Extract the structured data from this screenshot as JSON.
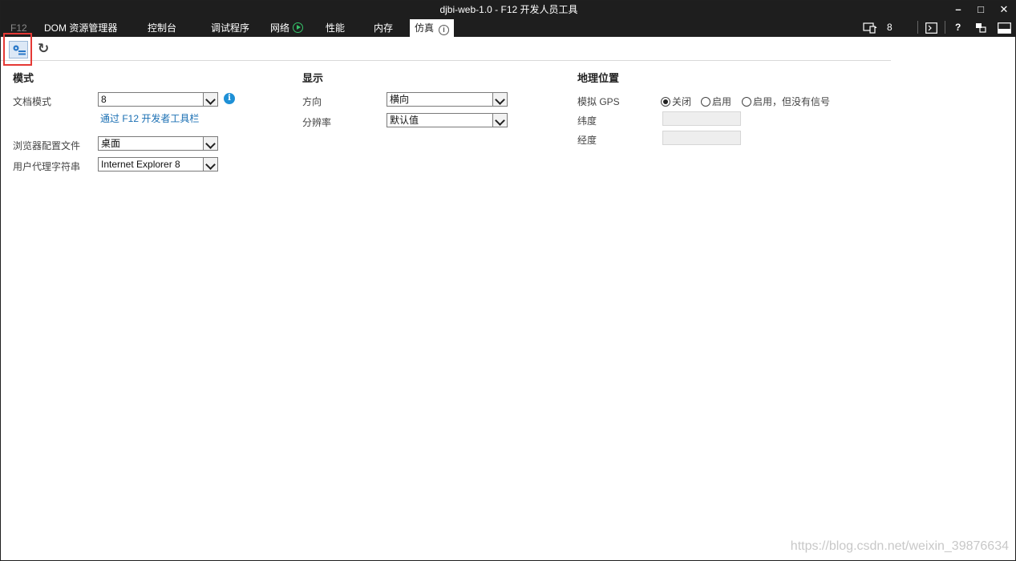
{
  "window": {
    "title": "djbi-web-1.0 - F12 开发人员工具",
    "controls": {
      "minimize": "–",
      "maximize": "□",
      "close": "✕"
    }
  },
  "tabs": [
    {
      "label": "F12"
    },
    {
      "label": "DOM 资源管理器"
    },
    {
      "label": "控制台"
    },
    {
      "label": "调试程序"
    },
    {
      "label": "网络"
    },
    {
      "label": "性能"
    },
    {
      "label": "内存"
    },
    {
      "label": "仿真",
      "active": true
    }
  ],
  "tabbar_right": {
    "target_count": "8",
    "help": "?"
  },
  "toolbar": {
    "undo_glyph": "↻"
  },
  "sections": {
    "mode": {
      "heading": "模式",
      "doc_mode_label": "文档模式",
      "doc_mode_value": "8",
      "doc_mode_link": "通过 F12 开发者工具栏",
      "browser_profile_label": "浏览器配置文件",
      "browser_profile_value": "桌面",
      "user_agent_label": "用户代理字符串",
      "user_agent_value": "Internet Explorer 8"
    },
    "display": {
      "heading": "显示",
      "orientation_label": "方向",
      "orientation_value": "横向",
      "resolution_label": "分辨率",
      "resolution_value": "默认值"
    },
    "geo": {
      "heading": "地理位置",
      "gps_label": "模拟 GPS",
      "gps_options": [
        "关闭",
        "启用",
        "启用，但没有信号"
      ],
      "gps_selected": 0,
      "latitude_label": "纬度",
      "longitude_label": "经度"
    }
  },
  "watermark": "https://blog.csdn.net/weixin_39876634"
}
